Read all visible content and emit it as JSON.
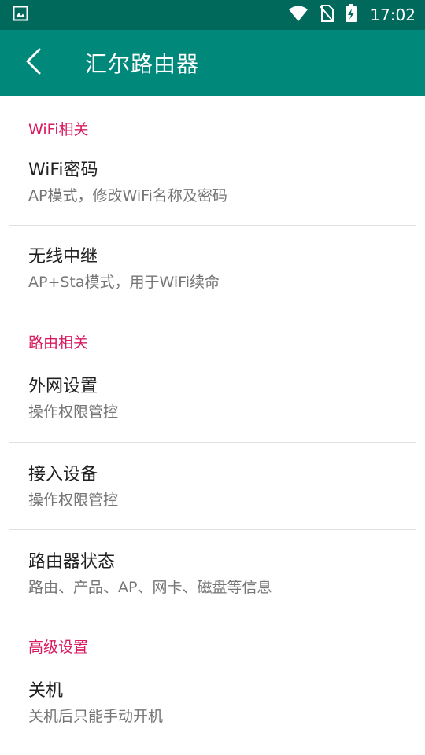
{
  "status_bar": {
    "time": "17:02",
    "icons": [
      "image-notification-icon",
      "wifi-icon",
      "no-sim-icon",
      "battery-charging-icon"
    ]
  },
  "app_bar": {
    "title": "汇尔路由器",
    "back_icon": "back-arrow-icon",
    "background": "#00897b",
    "status_background": "#00695c"
  },
  "accent_color": "#d81b60",
  "sections": [
    {
      "header": "WiFi相关",
      "items": [
        {
          "title": "WiFi密码",
          "summary": "AP模式，修改WiFi名称及密码"
        },
        {
          "title": "无线中继",
          "summary": "AP+Sta模式，用于WiFi续命"
        }
      ]
    },
    {
      "header": "路由相关",
      "items": [
        {
          "title": "外网设置",
          "summary": "操作权限管控"
        },
        {
          "title": "接入设备",
          "summary": "操作权限管控"
        },
        {
          "title": "路由器状态",
          "summary": "路由、产品、AP、网卡、磁盘等信息"
        }
      ]
    },
    {
      "header": "高级设置",
      "items": [
        {
          "title": "关机",
          "summary": "关机后只能手动开机"
        }
      ]
    }
  ]
}
